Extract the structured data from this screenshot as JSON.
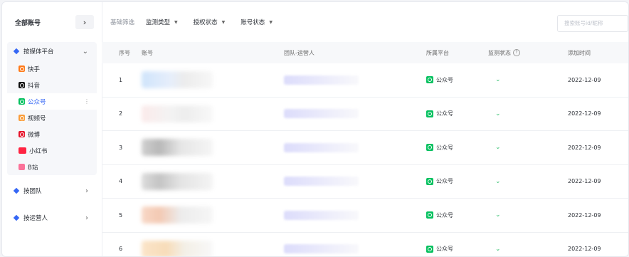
{
  "sidebar": {
    "title": "全部账号",
    "expand_icon": "chevron-right",
    "groups": [
      {
        "label": "按媒体平台",
        "expanded": true
      },
      {
        "label": "按团队",
        "expanded": false
      },
      {
        "label": "按运营人",
        "expanded": false
      }
    ],
    "platforms": [
      {
        "label": "快手"
      },
      {
        "label": "抖音"
      },
      {
        "label": "公众号",
        "active": true
      },
      {
        "label": "视频号"
      },
      {
        "label": "微博"
      },
      {
        "label": "小红书"
      },
      {
        "label": "B站"
      }
    ],
    "active_more": "⋮"
  },
  "filters": {
    "label": "基础筛选",
    "monitor_type": "监测类型",
    "auth_status": "授权状态",
    "account_status": "账号状态",
    "search_placeholder": "搜索账号id/昵称"
  },
  "table": {
    "headers": {
      "no": "序号",
      "account": "账号",
      "team": "团队-运营人",
      "platform": "所属平台",
      "monitor": "监测状态",
      "added": "添加时间"
    },
    "rows": [
      {
        "no": "1",
        "platform": "公众号",
        "added": "2022-12-09"
      },
      {
        "no": "2",
        "platform": "公众号",
        "added": "2022-12-09"
      },
      {
        "no": "3",
        "platform": "公众号",
        "added": "2022-12-09"
      },
      {
        "no": "4",
        "platform": "公众号",
        "added": "2022-12-09"
      },
      {
        "no": "5",
        "platform": "公众号",
        "added": "2022-12-09"
      },
      {
        "no": "6",
        "platform": "公众号",
        "added": "2022-12-09"
      }
    ]
  },
  "colors": {
    "accent": "#3567f5",
    "wechat": "#07c160"
  }
}
